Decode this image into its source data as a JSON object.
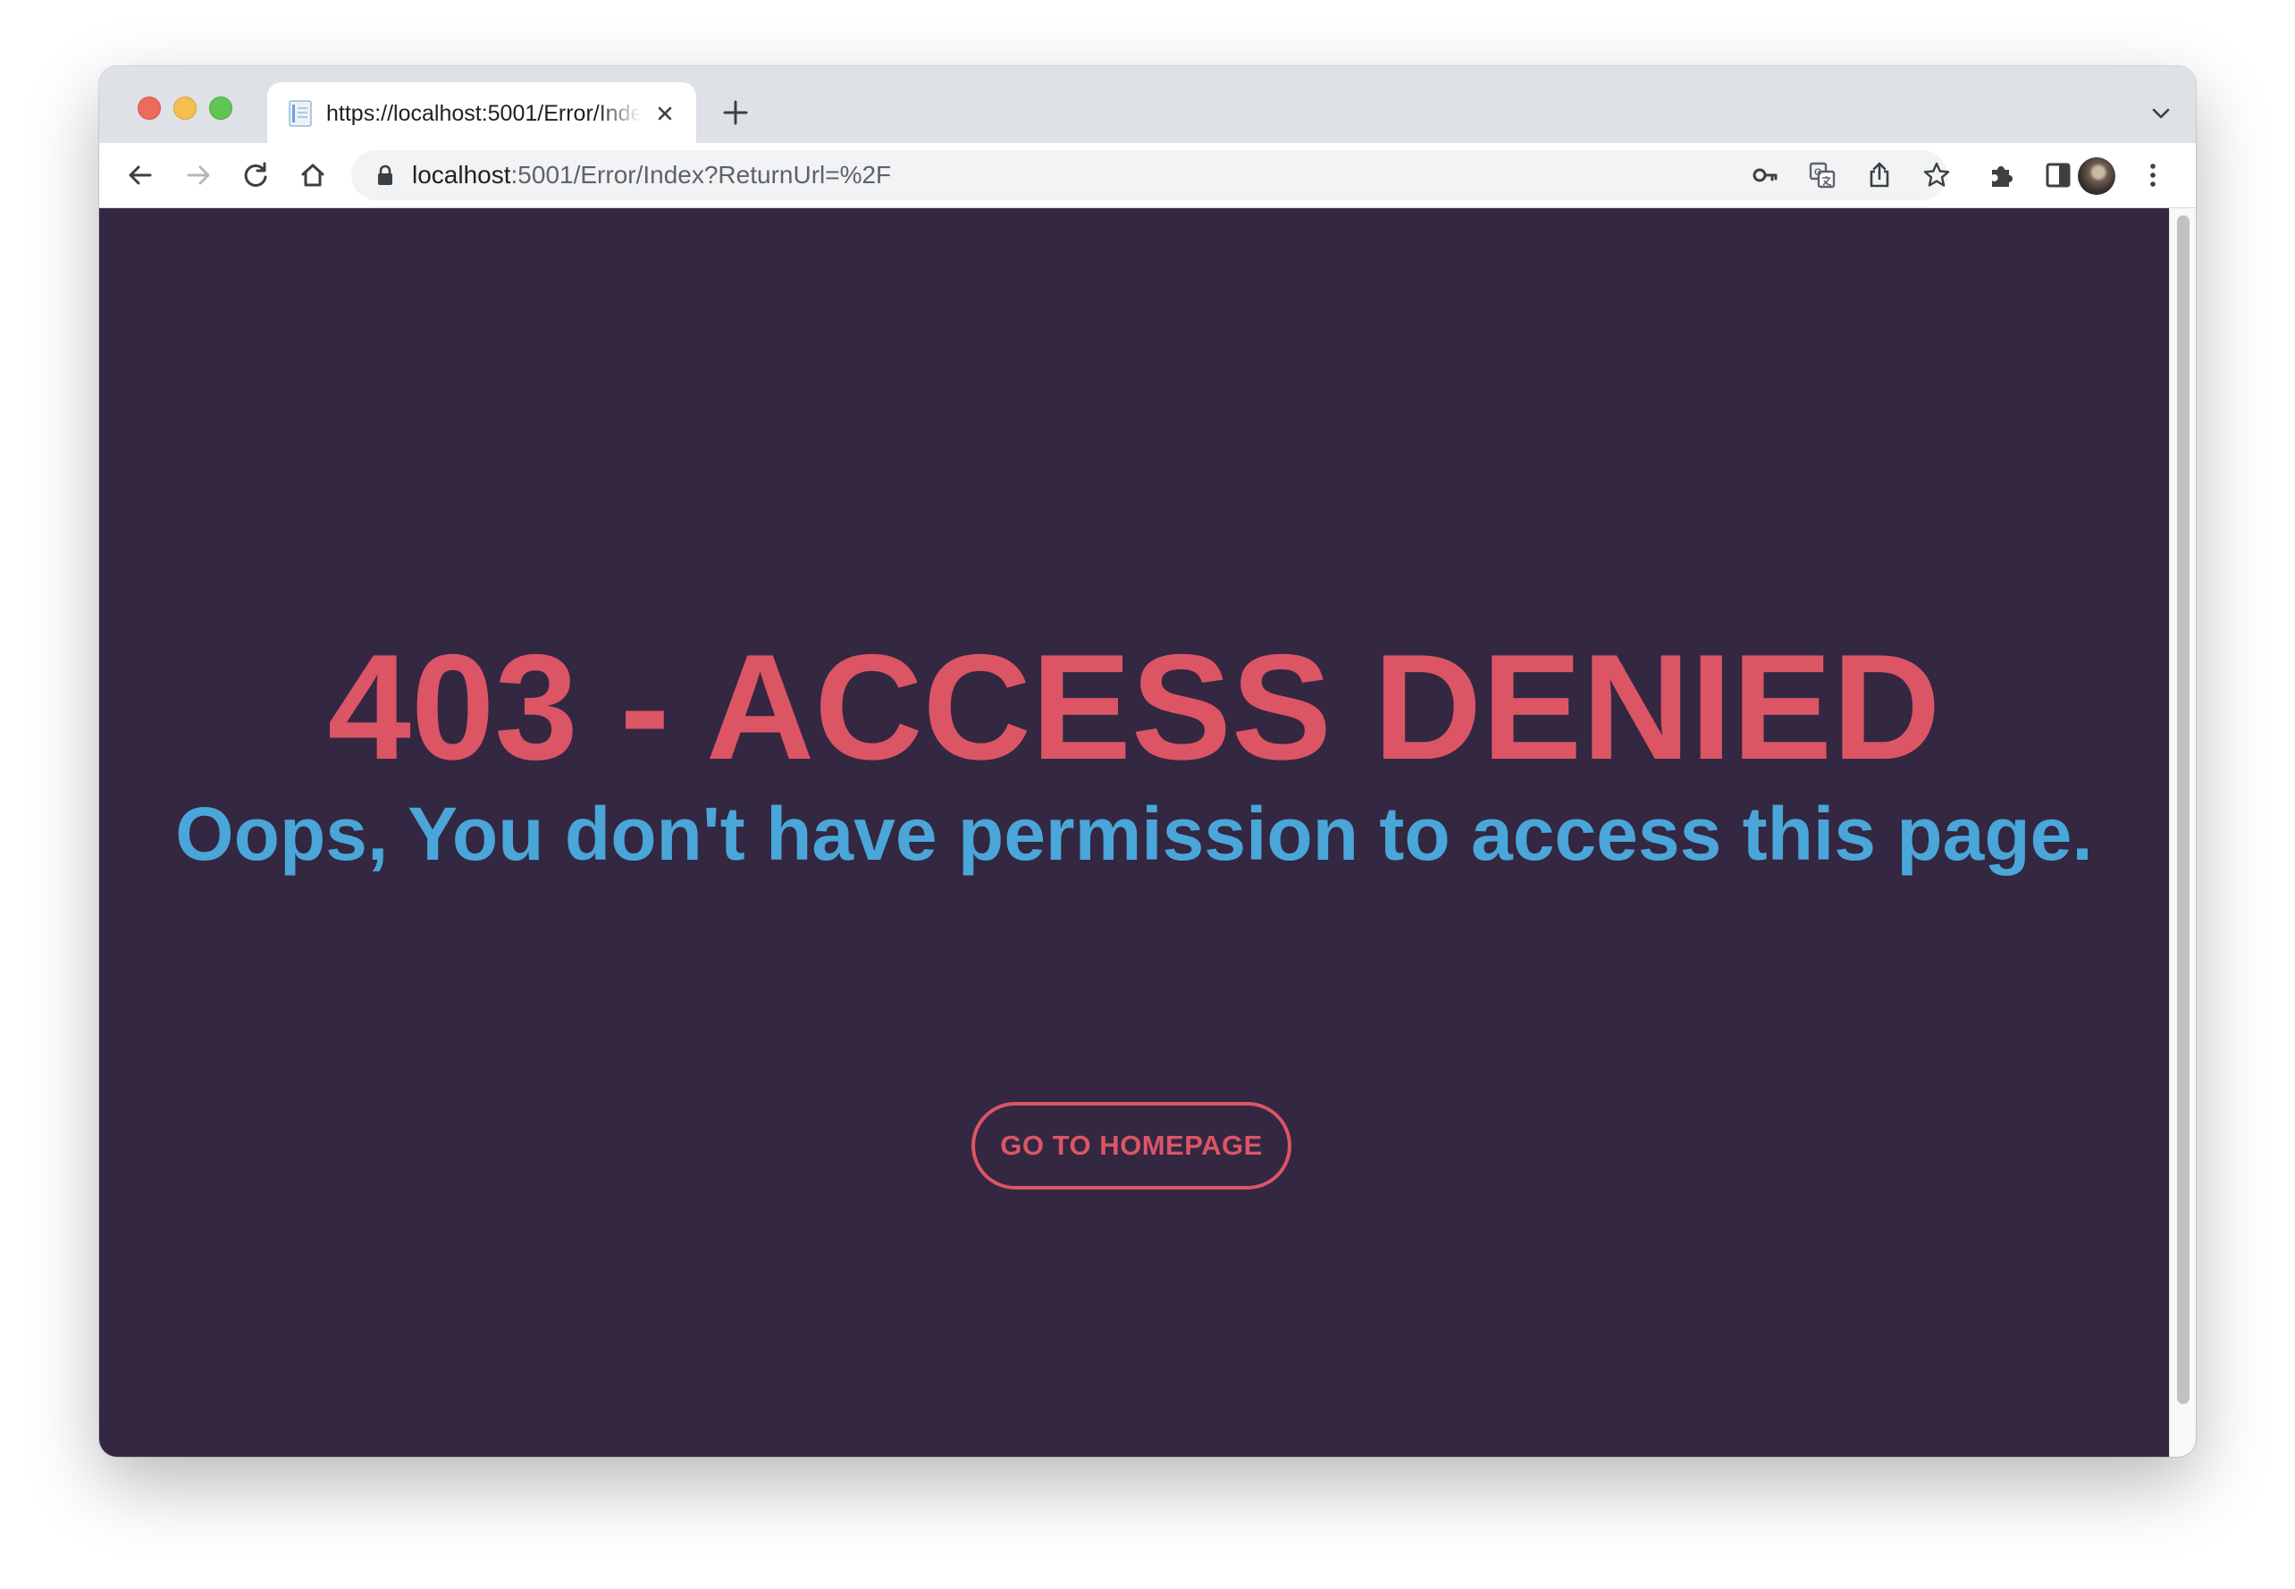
{
  "browser": {
    "tab": {
      "title": "https://localhost:5001/Error/Index?ReturnUrl=%2F",
      "icons": [
        "document-favicon-icon",
        "close-icon"
      ]
    },
    "new_tab_icon": "plus-icon",
    "tab_menu_icon": "chevron-down-icon",
    "toolbar": {
      "icons": [
        "back-arrow-icon",
        "forward-arrow-icon",
        "reload-icon",
        "home-icon"
      ],
      "omnibox": {
        "lock_icon": "lock-icon",
        "url_host": "localhost",
        "url_rest": ":5001/Error/Index?ReturnUrl=%2F",
        "right_icons": [
          "key-icon",
          "translate-icon",
          "share-icon",
          "star-icon"
        ]
      },
      "right_icons": [
        "extensions-puzzle-icon",
        "side-panel-icon",
        "profile-avatar",
        "more-vertical-icon"
      ]
    }
  },
  "page": {
    "background": "#332742",
    "headline": "403 - ACCESS DENIED",
    "headline_color": "#dc5565",
    "subline": "Oops, You don't have permission to access this page.",
    "subline_color": "#4aa6d8",
    "button_label": "GO TO HOMEPAGE",
    "button_color": "#dc5565"
  }
}
